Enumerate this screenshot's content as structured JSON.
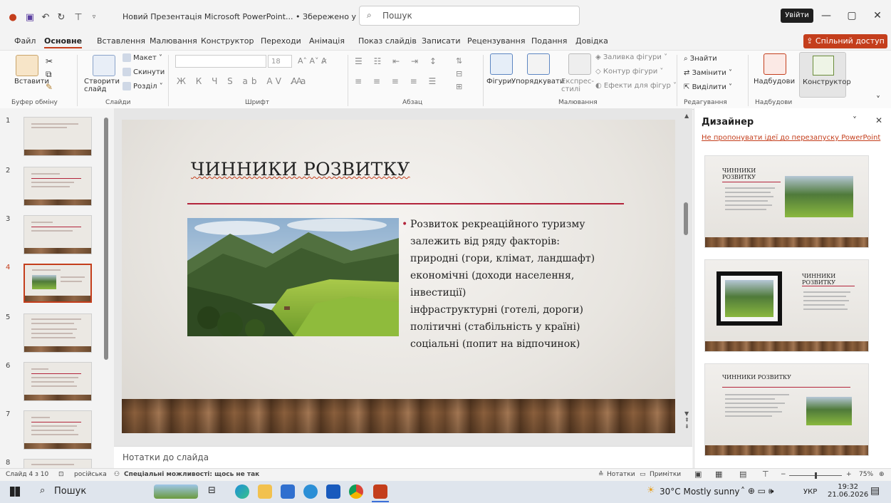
{
  "titlebar": {
    "doc_title": "Новий Презентація Microsoft PowerPoint... • Збережено у цей ПК",
    "search_placeholder": "Пошук",
    "signin": "Увійти",
    "minimize": "—",
    "restore": "▢",
    "close": "✕"
  },
  "menu": {
    "tabs": [
      "Файл",
      "Основне",
      "Вставлення",
      "Малювання",
      "Конструктор",
      "Переходи",
      "Анімація",
      "Показ слайдів",
      "Записати",
      "Рецензування",
      "Подання",
      "Довідка"
    ],
    "share": "Спільний доступ"
  },
  "ribbon": {
    "paste": "Вставити",
    "clipboard_group": "Буфер обміну",
    "new_slide": "Створити слайд",
    "layout": "Макет",
    "reset": "Скинути",
    "section": "Розділ",
    "slides_group": "Слайди",
    "font_size": "18",
    "font_group": "Шрифт",
    "paragraph_group": "Абзац",
    "shapes": "Фігури",
    "arrange": "Упорядкувати",
    "quick_styles": "Експрес-стилі",
    "shape_fill": "Заливка фігури",
    "shape_outline": "Контур фігури",
    "shape_effects": "Ефекти для фігур",
    "drawing_group": "Малювання",
    "find": "Знайти",
    "replace": "Замінити",
    "select": "Виділити",
    "editing_group": "Редагування",
    "addins": "Надбудови",
    "addins_group": "Надбудови",
    "designer": "Конструктор"
  },
  "thumbnails": {
    "numbers": [
      "1",
      "2",
      "3",
      "4",
      "5",
      "6",
      "7",
      "8"
    ],
    "selected": 4
  },
  "slide": {
    "title": "ЧИННИКИ РОЗВИТКУ",
    "bullet": "•",
    "lines": [
      "Розвиток рекреаційного туризму",
      "залежить від ряду факторів:",
      "природні (гори, клімат, ландшафт)",
      "економічні (доходи населення,",
      "інвестиції)",
      "інфраструктурні (готелі, дороги)",
      "політичні (стабільність у країні)",
      "соціальні (попит на відпочинок)"
    ]
  },
  "notes": {
    "placeholder": "Нотатки до слайда"
  },
  "designer": {
    "title": "Дизайнер",
    "link": "Не пропонувати ідеї до перезапуску PowerPoint",
    "card_title": "ЧИННИКИ РОЗВИТКУ",
    "card_title_short_1": "ЧИННИКИ",
    "card_title_short_2": "РОЗВИТКУ"
  },
  "statusbar": {
    "slide_pos": "Слайд 4 з 10",
    "language": "російська",
    "accessibility": "Спеціальні можливості: щось не так",
    "notes": "Нотатки",
    "comments": "Примітки",
    "zoom": "75%"
  },
  "taskbar": {
    "search": "Пошук",
    "weather": "30°C  Mostly sunny",
    "lang": "УКР",
    "time": "19:32",
    "date": "21.06.2026"
  },
  "colors": {
    "accent": "#c43e1c",
    "slide_accent": "#b3243b"
  }
}
